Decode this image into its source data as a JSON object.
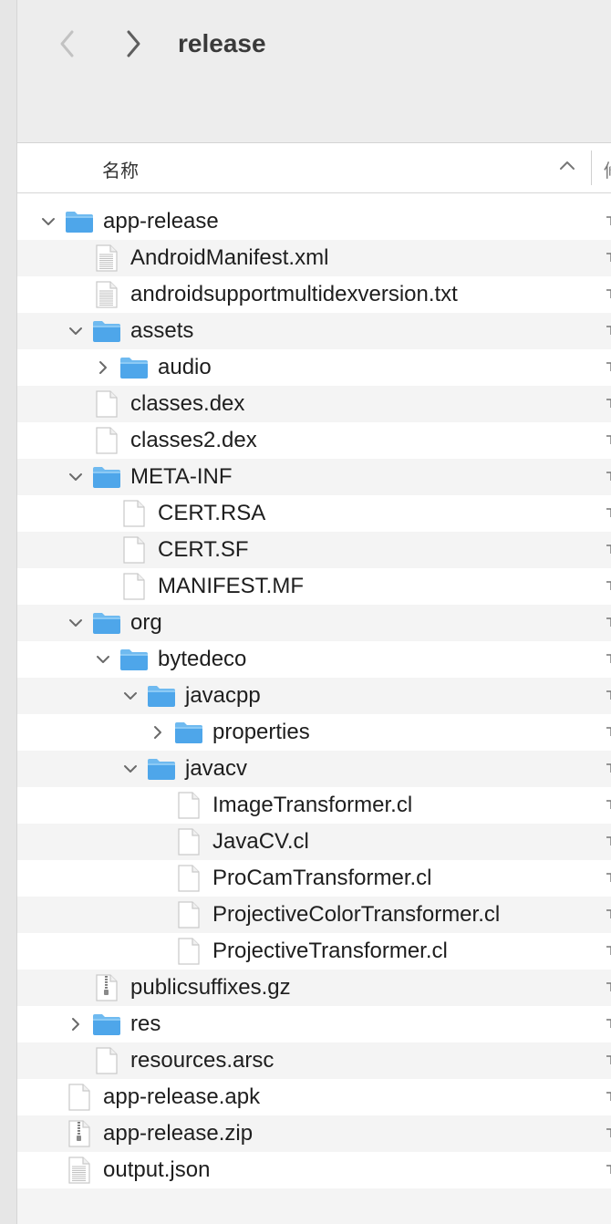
{
  "window": {
    "title": "release"
  },
  "toolbar": {
    "back_icon": "chevron-left-icon",
    "forward_icon": "chevron-right-icon"
  },
  "header": {
    "name_column": "名称",
    "next_column": "修",
    "sort_icon": "chevron-up-icon"
  },
  "rows": [
    {
      "name": "app-release",
      "type": "folder",
      "depth": 0,
      "expander": "open"
    },
    {
      "name": "AndroidManifest.xml",
      "type": "text",
      "depth": 1,
      "expander": "none"
    },
    {
      "name": "androidsupportmultidexversion.txt",
      "type": "text",
      "depth": 1,
      "expander": "none"
    },
    {
      "name": "assets",
      "type": "folder",
      "depth": 1,
      "expander": "open"
    },
    {
      "name": "audio",
      "type": "folder",
      "depth": 2,
      "expander": "closed"
    },
    {
      "name": "classes.dex",
      "type": "file",
      "depth": 1,
      "expander": "none"
    },
    {
      "name": "classes2.dex",
      "type": "file",
      "depth": 1,
      "expander": "none"
    },
    {
      "name": "META-INF",
      "type": "folder",
      "depth": 1,
      "expander": "open"
    },
    {
      "name": "CERT.RSA",
      "type": "file",
      "depth": 2,
      "expander": "none"
    },
    {
      "name": "CERT.SF",
      "type": "file",
      "depth": 2,
      "expander": "none"
    },
    {
      "name": "MANIFEST.MF",
      "type": "file",
      "depth": 2,
      "expander": "none"
    },
    {
      "name": "org",
      "type": "folder",
      "depth": 1,
      "expander": "open"
    },
    {
      "name": "bytedeco",
      "type": "folder",
      "depth": 2,
      "expander": "open"
    },
    {
      "name": "javacpp",
      "type": "folder",
      "depth": 3,
      "expander": "open"
    },
    {
      "name": "properties",
      "type": "folder",
      "depth": 4,
      "expander": "closed"
    },
    {
      "name": "javacv",
      "type": "folder",
      "depth": 3,
      "expander": "open"
    },
    {
      "name": "ImageTransformer.cl",
      "type": "file",
      "depth": 4,
      "expander": "none"
    },
    {
      "name": "JavaCV.cl",
      "type": "file",
      "depth": 4,
      "expander": "none"
    },
    {
      "name": "ProCamTransformer.cl",
      "type": "file",
      "depth": 4,
      "expander": "none"
    },
    {
      "name": "ProjectiveColorTransformer.cl",
      "type": "file",
      "depth": 4,
      "expander": "none"
    },
    {
      "name": "ProjectiveTransformer.cl",
      "type": "file",
      "depth": 4,
      "expander": "none"
    },
    {
      "name": "publicsuffixes.gz",
      "type": "archive",
      "depth": 1,
      "expander": "none"
    },
    {
      "name": "res",
      "type": "folder",
      "depth": 1,
      "expander": "closed"
    },
    {
      "name": "resources.arsc",
      "type": "file",
      "depth": 1,
      "expander": "none"
    },
    {
      "name": "app-release.apk",
      "type": "file",
      "depth": 0,
      "expander": "none"
    },
    {
      "name": "app-release.zip",
      "type": "archive",
      "depth": 0,
      "expander": "none"
    },
    {
      "name": "output.json",
      "type": "text",
      "depth": 0,
      "expander": "none"
    }
  ],
  "colors": {
    "folder": "#4ea6ea",
    "folder_tab": "#6fbaf0",
    "alt_row": "#f4f4f4",
    "toolbar": "#ededed"
  }
}
